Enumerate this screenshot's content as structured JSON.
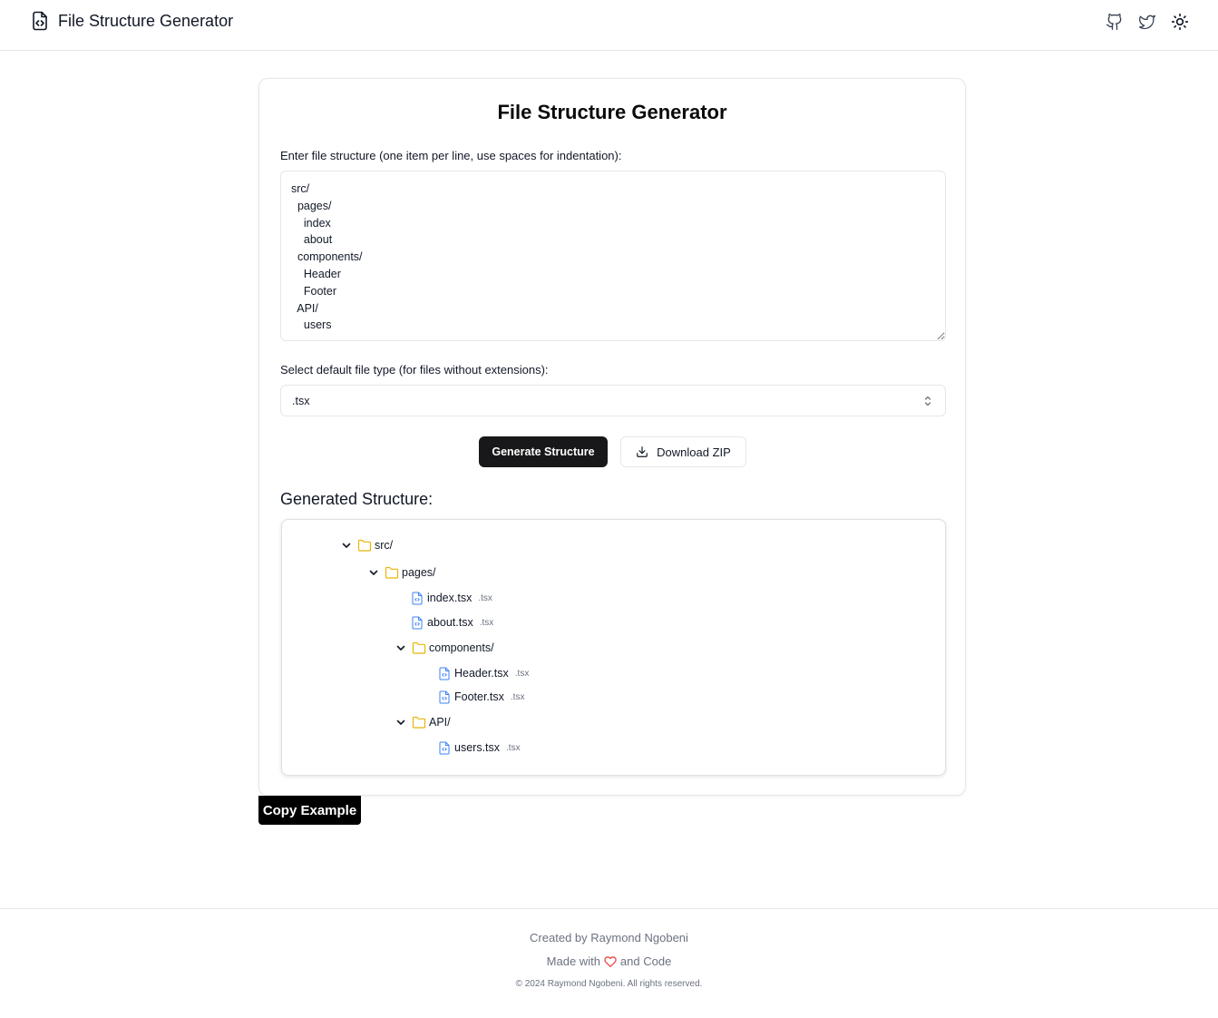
{
  "header": {
    "title": "File Structure Generator",
    "icons": [
      "file-code-icon",
      "github-icon",
      "twitter-icon",
      "sun-icon"
    ]
  },
  "card": {
    "title": "File Structure Generator",
    "input_label": "Enter file structure (one item per line, use spaces for indentation):",
    "input_value": "src/\n  pages/\n    index\n    about\n  components/\n    Header\n    Footer\n  API/\n    users",
    "select_label": "Select default file type (for files without extensions):",
    "select_value": ".tsx",
    "generate_label": "Generate Structure",
    "download_label": "Download ZIP",
    "generated_title": "Generated Structure:",
    "tree": {
      "src": "src/",
      "pages": "pages/",
      "index": "index.tsx",
      "about": "about.tsx",
      "components": "components/",
      "header": "Header.tsx",
      "footer": "Footer.tsx",
      "api": "API/",
      "users": "users.tsx",
      "ext": ".tsx"
    }
  },
  "copy_example_label": "Copy Example",
  "footer": {
    "created_by": "Created by Raymond Ngobeni",
    "made_with": "Made with",
    "and_code": "and Code",
    "copyright": "© 2024 Raymond Ngobeni. All rights reserved."
  },
  "colors": {
    "folder": "#eab308",
    "file": "#3b82f6",
    "heart": "#ef4444",
    "primary_button": "#18181b"
  }
}
